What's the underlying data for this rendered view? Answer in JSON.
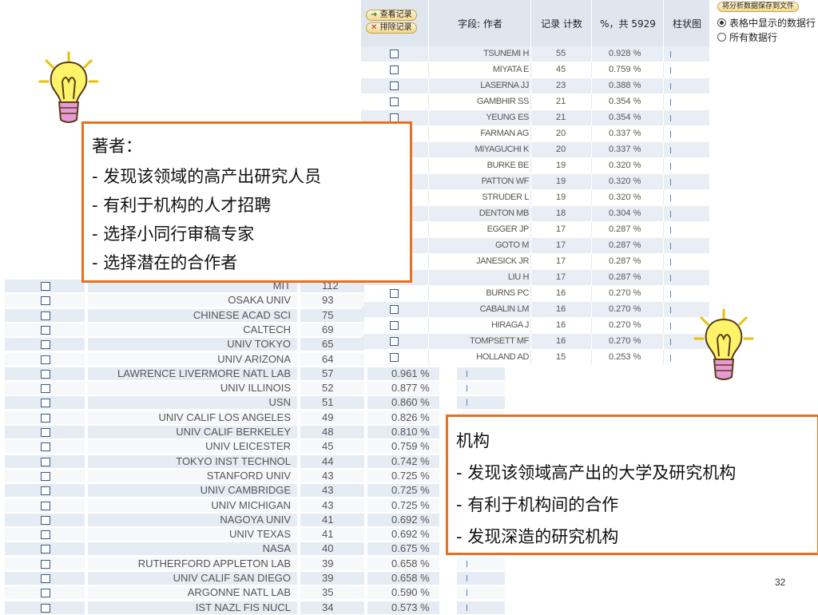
{
  "author_table": {
    "buttons": {
      "view": "查看记录",
      "exclude": "排除记录"
    },
    "headers": {
      "field": "字段: 作者",
      "count": "记录 计数",
      "percent": "%，共 5929",
      "bar": "柱状图"
    },
    "save_button": "将分析数据保存到文件",
    "radio_options": [
      {
        "label": "表格中显示的数据行",
        "selected": true
      },
      {
        "label": "所有数据行",
        "selected": false
      }
    ],
    "rows": [
      {
        "name": "TSUNEMI H",
        "count": "55",
        "percent": "0.928 %"
      },
      {
        "name": "MIYATA E",
        "count": "45",
        "percent": "0.759 %"
      },
      {
        "name": "LASERNA JJ",
        "count": "23",
        "percent": "0.388 %"
      },
      {
        "name": "GAMBHIR SS",
        "count": "21",
        "percent": "0.354 %"
      },
      {
        "name": "YEUNG ES",
        "count": "21",
        "percent": "0.354 %"
      },
      {
        "name": "FARMAN AG",
        "count": "20",
        "percent": "0.337 %"
      },
      {
        "name": "MIYAGUCHI K",
        "count": "20",
        "percent": "0.337 %"
      },
      {
        "name": "BURKE BE",
        "count": "19",
        "percent": "0.320 %"
      },
      {
        "name": "PATTON WF",
        "count": "19",
        "percent": "0.320 %"
      },
      {
        "name": "STRUDER L",
        "count": "19",
        "percent": "0.320 %"
      },
      {
        "name": "DENTON MB",
        "count": "18",
        "percent": "0.304 %"
      },
      {
        "name": "EGGER JP",
        "count": "17",
        "percent": "0.287 %"
      },
      {
        "name": "GOTO M",
        "count": "17",
        "percent": "0.287 %"
      },
      {
        "name": "JANESICK JR",
        "count": "17",
        "percent": "0.287 %"
      },
      {
        "name": "LIU H",
        "count": "17",
        "percent": "0.287 %"
      },
      {
        "name": "BURNS PC",
        "count": "16",
        "percent": "0.270 %"
      },
      {
        "name": "CABALIN LM",
        "count": "16",
        "percent": "0.270 %"
      },
      {
        "name": "HIRAGA J",
        "count": "16",
        "percent": "0.270 %"
      },
      {
        "name": "TOMPSETT MF",
        "count": "16",
        "percent": "0.270 %"
      },
      {
        "name": "HOLLAND AD",
        "count": "15",
        "percent": "0.253 %"
      }
    ]
  },
  "institution_table": {
    "rows": [
      {
        "name": "MIT",
        "count": "112",
        "percent": ""
      },
      {
        "name": "OSAKA UNIV",
        "count": "93",
        "percent": ""
      },
      {
        "name": "CHINESE ACAD SCI",
        "count": "75",
        "percent": ""
      },
      {
        "name": "CALTECH",
        "count": "69",
        "percent": ""
      },
      {
        "name": "UNIV TOKYO",
        "count": "65",
        "percent": ""
      },
      {
        "name": "UNIV ARIZONA",
        "count": "64",
        "percent": ""
      },
      {
        "name": "LAWRENCE LIVERMORE NATL LAB",
        "count": "57",
        "percent": "0.961 %"
      },
      {
        "name": "UNIV ILLINOIS",
        "count": "52",
        "percent": "0.877 %"
      },
      {
        "name": "USN",
        "count": "51",
        "percent": "0.860 %"
      },
      {
        "name": "UNIV CALIF LOS ANGELES",
        "count": "49",
        "percent": "0.826 %"
      },
      {
        "name": "UNIV CALIF BERKELEY",
        "count": "48",
        "percent": "0.810 %"
      },
      {
        "name": "UNIV LEICESTER",
        "count": "45",
        "percent": "0.759 %"
      },
      {
        "name": "TOKYO INST TECHNOL",
        "count": "44",
        "percent": "0.742 %"
      },
      {
        "name": "STANFORD UNIV",
        "count": "43",
        "percent": "0.725 %"
      },
      {
        "name": "UNIV CAMBRIDGE",
        "count": "43",
        "percent": "0.725 %"
      },
      {
        "name": "UNIV MICHIGAN",
        "count": "43",
        "percent": "0.725 %"
      },
      {
        "name": "NAGOYA UNIV",
        "count": "41",
        "percent": "0.692 %"
      },
      {
        "name": "UNIV TEXAS",
        "count": "41",
        "percent": "0.692 %"
      },
      {
        "name": "NASA",
        "count": "40",
        "percent": "0.675 %"
      },
      {
        "name": "RUTHERFORD APPLETON LAB",
        "count": "39",
        "percent": "0.658 %"
      },
      {
        "name": "UNIV CALIF SAN DIEGO",
        "count": "39",
        "percent": "0.658 %"
      },
      {
        "name": "ARGONNE NATL LAB",
        "count": "35",
        "percent": "0.590 %"
      },
      {
        "name": "IST NAZL FIS NUCL",
        "count": "34",
        "percent": "0.573 %"
      }
    ]
  },
  "callout_authors": {
    "title": "著者：",
    "lines": [
      "- 发现该领域的高产出研究人员",
      "- 有利于机构的人才招聘",
      "- 选择小同行审稿专家",
      "- 选择潜在的合作者"
    ]
  },
  "callout_institutions": {
    "title": "机构",
    "lines": [
      "- 发现该领域高产出的大学及研究机构",
      "- 有利于机构间的合作",
      "- 发现深造的研究机构"
    ]
  },
  "page_number": "32",
  "colors": {
    "accent_border": "#e8701e",
    "row_shade": "#e6ecf3",
    "bar": "#5b82c0"
  },
  "icons": [
    "lightbulb-icon",
    "checkbox-icon",
    "radio-icon"
  ]
}
